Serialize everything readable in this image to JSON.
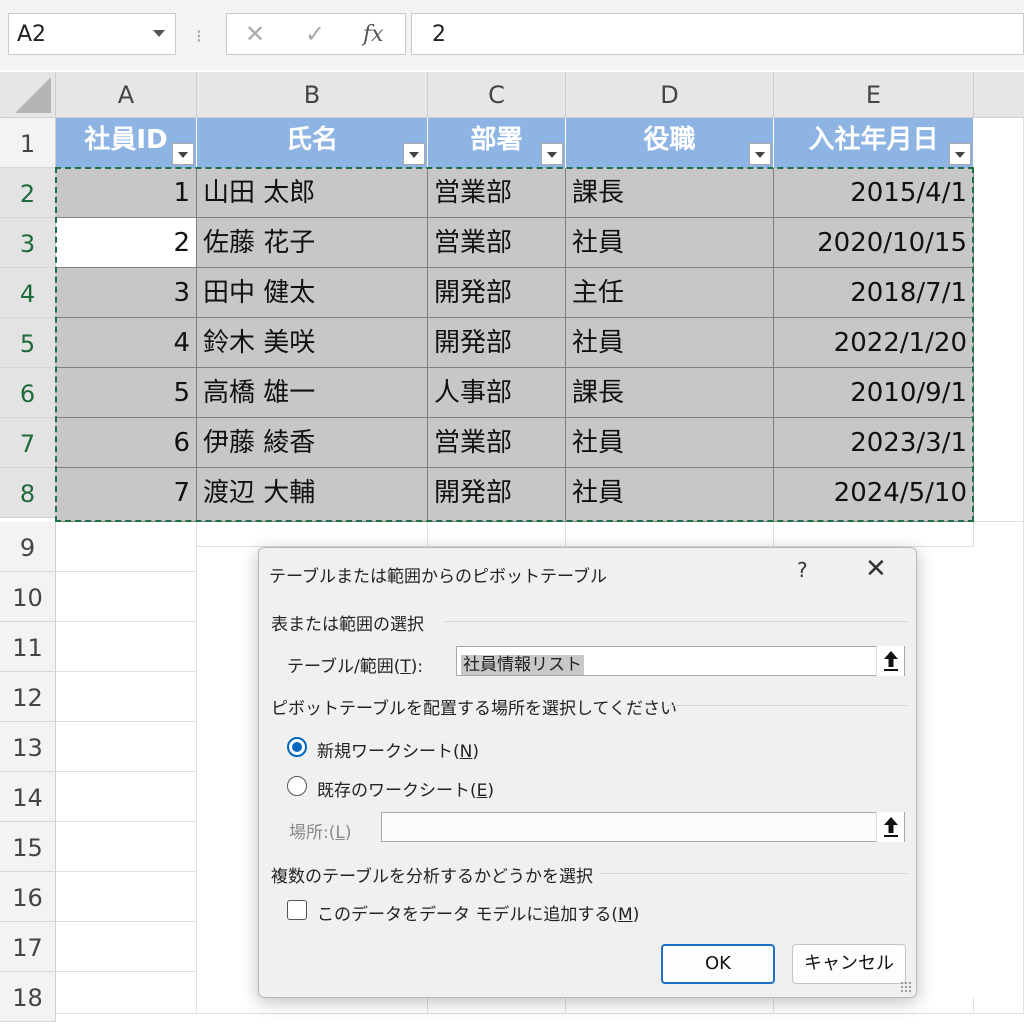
{
  "formula_bar": {
    "name_box": "A2",
    "separator": "⁝",
    "cancel_icon": "✕",
    "enter_icon": "✓",
    "fx_label": "fx",
    "value": "2"
  },
  "grid": {
    "columns": [
      "A",
      "B",
      "C",
      "D",
      "E"
    ],
    "rows": [
      "1",
      "2",
      "3",
      "4",
      "5",
      "6",
      "7",
      "8",
      "9",
      "10",
      "11",
      "12",
      "13",
      "14",
      "15",
      "16",
      "17",
      "18"
    ]
  },
  "table": {
    "headers": [
      "社員ID",
      "氏名",
      "部署",
      "役職",
      "入社年月日"
    ],
    "rows": [
      [
        "1",
        "山田 太郎",
        "営業部",
        "課長",
        "2015/4/1"
      ],
      [
        "2",
        "佐藤 花子",
        "営業部",
        "社員",
        "2020/10/15"
      ],
      [
        "3",
        "田中 健太",
        "開発部",
        "主任",
        "2018/7/1"
      ],
      [
        "4",
        "鈴木 美咲",
        "開発部",
        "社員",
        "2022/1/20"
      ],
      [
        "5",
        "高橋 雄一",
        "人事部",
        "課長",
        "2010/9/1"
      ],
      [
        "6",
        "伊藤 綾香",
        "営業部",
        "社員",
        "2023/3/1"
      ],
      [
        "7",
        "渡辺 大輔",
        "開発部",
        "社員",
        "2024/5/10"
      ]
    ]
  },
  "dialog": {
    "title": "テーブルまたは範囲からのピボットテーブル",
    "help": "?",
    "close": "✕",
    "section1": "表または範囲の選択",
    "table_range_label_pre": "テーブル/範囲(",
    "table_range_key": "T",
    "table_range_label_post": "):",
    "table_range_value": "社員情報リスト",
    "section2": "ピボットテーブルを配置する場所を選択してください",
    "new_sheet_pre": "新規ワークシート(",
    "new_sheet_key": "N",
    "new_sheet_post": ")",
    "existing_sheet_pre": "既存のワークシート(",
    "existing_sheet_key": "E",
    "existing_sheet_post": ")",
    "location_pre": "場所:(",
    "location_key": "L",
    "location_post": ")",
    "location_value": "",
    "section3": "複数のテーブルを分析するかどうかを選択",
    "data_model_pre": "このデータをデータ モデルに追加する(",
    "data_model_key": "M",
    "data_model_post": ")",
    "ok": "OK",
    "cancel": "キャンセル"
  }
}
